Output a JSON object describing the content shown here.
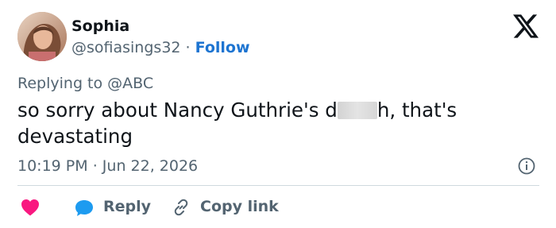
{
  "author": {
    "name": "Sophia",
    "handle": "@sofiasings32",
    "separator": "·",
    "follow_label": "Follow"
  },
  "logo_icon": "x-logo-icon",
  "reply_context": "Replying to @ABC",
  "tweet": {
    "text_before": "so sorry about Nancy Guthrie's d",
    "text_after": "h, that's devastating"
  },
  "meta": {
    "time": "10:19 PM",
    "separator": "·",
    "date": "Jun 22, 2026"
  },
  "actions": {
    "like_icon": "heart-icon",
    "reply_icon": "reply-bubble-icon",
    "reply_label": "Reply",
    "copy_icon": "link-icon",
    "copy_label": "Copy link"
  },
  "colors": {
    "text": "#0f1419",
    "secondary": "#536471",
    "link": "#1d74d1",
    "heart": "#f91880",
    "reply": "#1d9bf0",
    "divider": "#cfd9de"
  }
}
